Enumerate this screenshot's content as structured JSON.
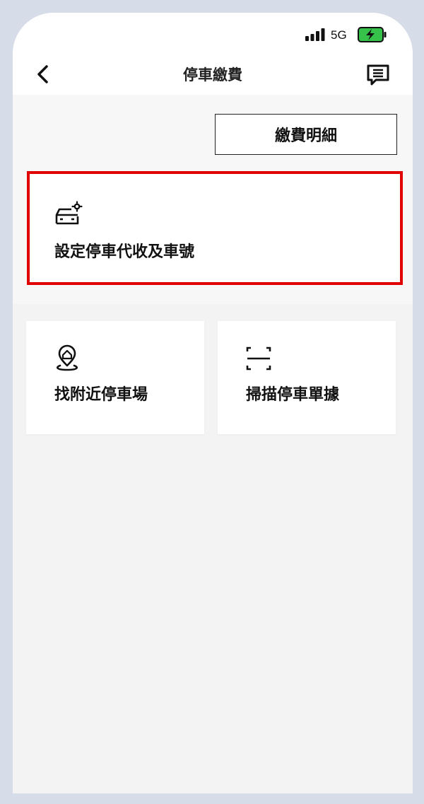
{
  "status_bar": {
    "network": "5G"
  },
  "nav": {
    "title": "停車繳費"
  },
  "actions": {
    "payment_details_label": "繳費明細",
    "settings_label": "設定停車代收及車號"
  },
  "cards": {
    "nearby_parking_label": "找附近停車場",
    "scan_ticket_label": "掃描停車單據"
  },
  "colors": {
    "highlight": "#e00000",
    "battery": "#36c24a",
    "frame": "#d6dde8"
  },
  "icons": {
    "back": "chevron-left-icon",
    "message": "message-icon",
    "car_settings": "car-gear-icon",
    "location": "location-pin-icon",
    "scan": "scan-frame-icon"
  }
}
